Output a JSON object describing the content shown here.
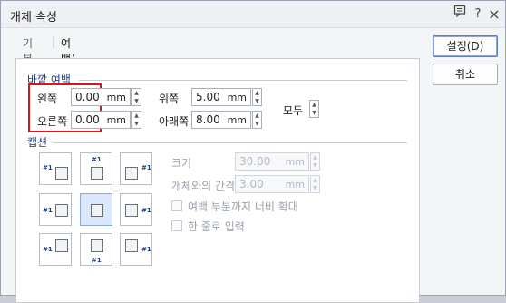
{
  "window": {
    "title": "개체 속성",
    "comment_icon": "comment-icon",
    "help_label": "?",
    "close_label": "×"
  },
  "tabs": [
    {
      "label": "기본",
      "active": false
    },
    {
      "label": "여백/캡션",
      "active": true
    }
  ],
  "tab_separator": "|",
  "outer_margin": {
    "title": "바깥 여백",
    "left": {
      "label": "왼쪽",
      "value": "0.00",
      "unit": "mm"
    },
    "right": {
      "label": "오른쪽",
      "value": "0.00",
      "unit": "mm"
    },
    "top": {
      "label": "위쪽",
      "value": "5.00",
      "unit": "mm"
    },
    "bottom": {
      "label": "아래쪽",
      "value": "8.00",
      "unit": "mm"
    },
    "all": {
      "label": "모두"
    }
  },
  "caption": {
    "title": "캡션",
    "position_tag": "#1",
    "selected_position": "none",
    "size": {
      "label": "크기",
      "value": "30.00",
      "unit": "mm",
      "enabled": false
    },
    "gap": {
      "label": "개체와의 간격",
      "value": "3.00",
      "unit": "mm",
      "enabled": false
    },
    "extend_width": {
      "label": "여백 부분까지 너비 확대",
      "checked": false,
      "enabled": false
    },
    "single_line": {
      "label": "한 줄로 입력",
      "checked": false,
      "enabled": false
    }
  },
  "buttons": {
    "ok": "설정(D)",
    "cancel": "취소"
  },
  "colors": {
    "section_title": "#1d3f8f",
    "highlight": "#d8161b",
    "selected_position": "#dbe7fb"
  }
}
